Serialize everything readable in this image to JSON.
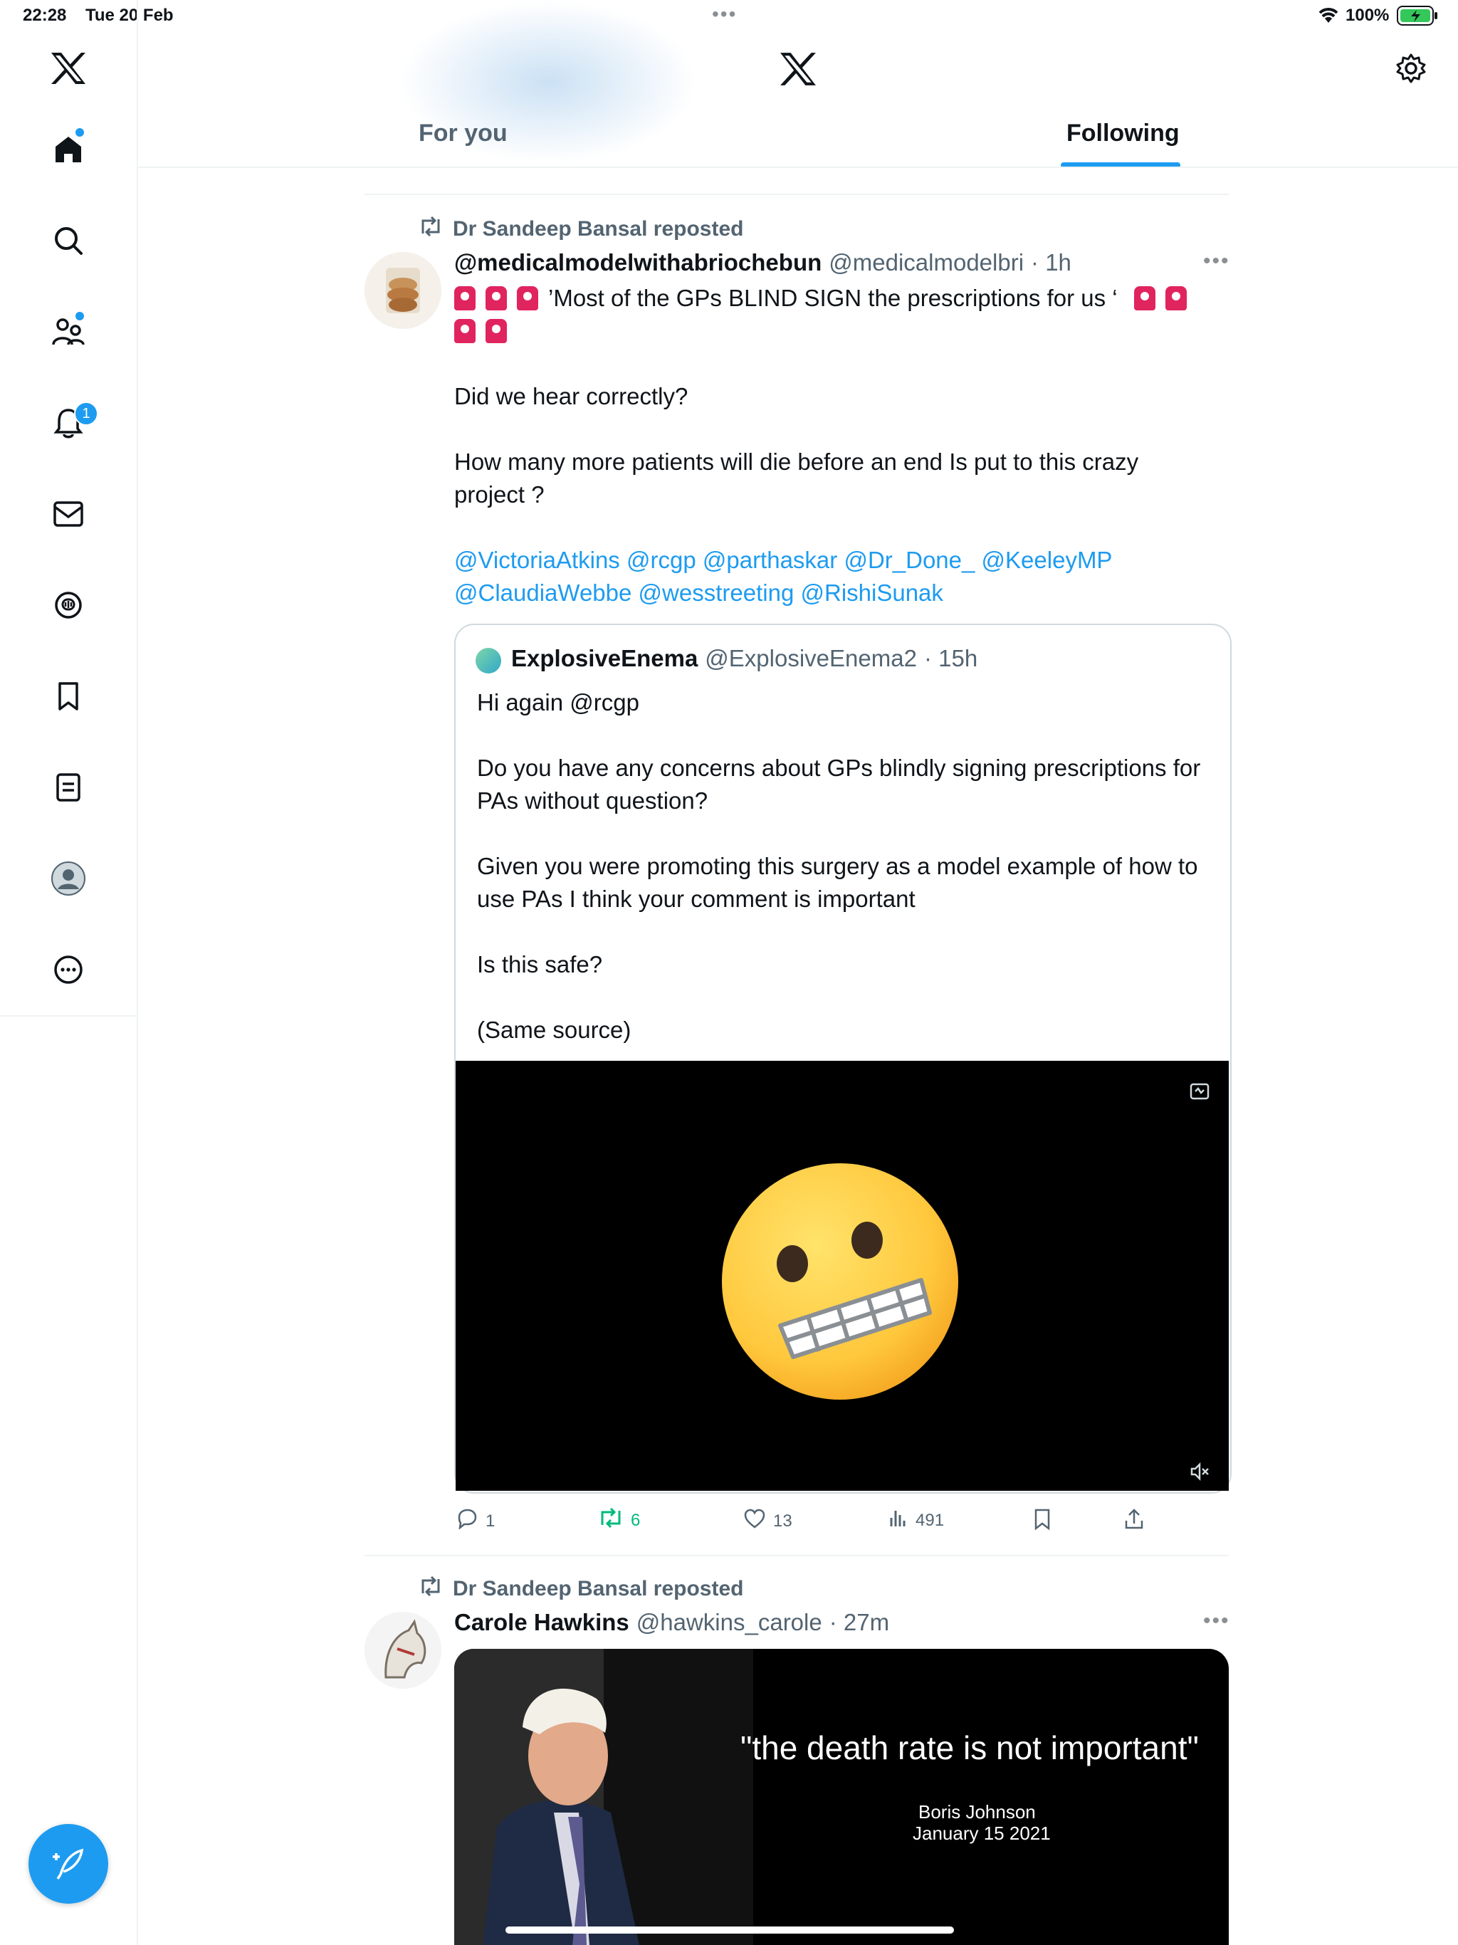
{
  "status_bar": {
    "time": "22:28",
    "date": "Tue 20 Feb",
    "battery": "100%"
  },
  "sidebar": {
    "items": [
      {
        "icon": "home-icon"
      },
      {
        "icon": "search-icon"
      },
      {
        "icon": "communities-icon"
      },
      {
        "icon": "bell-icon",
        "badge": "1"
      },
      {
        "icon": "mail-icon"
      },
      {
        "icon": "spaces-icon"
      },
      {
        "icon": "bookmark-icon"
      },
      {
        "icon": "lists-icon"
      },
      {
        "icon": "profile-icon"
      },
      {
        "icon": "more-icon"
      }
    ]
  },
  "header": {
    "logo": "x-logo-icon",
    "settings": "gear-icon"
  },
  "tabs": [
    {
      "label": "For you"
    },
    {
      "label": "Following",
      "active": true
    }
  ],
  "feed": {
    "tweet1": {
      "repost_label": "Dr Sandeep Bansal reposted",
      "name": "@medicalmodelwithabriochebun",
      "handle": "@medicalmodelbri",
      "time": "· 1h",
      "line1": "’Most of the GPs BLIND SIGN the prescriptions for us ‘",
      "p2": "Did we hear correctly?",
      "p3": "How many more patients will die before an end Is put to this crazy project ?",
      "mentions": [
        "@VictoriaAtkins",
        "@rcgp",
        "@parthaskar",
        "@Dr_Done_",
        "@KeeleyMP",
        "@ClaudiaWebbe",
        "@wesstreeting",
        "@RishiSunak"
      ],
      "quote": {
        "name": "ExplosiveEnema",
        "handle": "@ExplosiveEnema2",
        "time": "· 15h",
        "p1": "Hi again @rcgp",
        "p2": "Do you have any concerns about GPs blindly signing prescriptions for PAs without question?",
        "p3": "Given you were promoting this surgery as a model example of how to use PAs I think your comment is important",
        "p4": "Is this safe?",
        "p5": "(Same source)"
      },
      "actions": {
        "replies": "1",
        "reposts": "6",
        "likes": "13",
        "views": "491"
      }
    },
    "tweet2": {
      "repost_label": "Dr Sandeep Bansal reposted",
      "name": "Carole Hawkins",
      "handle": "@hawkins_carole",
      "time": "· 27m",
      "media_quote": "\"the death rate is not important\"",
      "media_attrib_name": "Boris Johnson",
      "media_attrib_date": "January 15 2021"
    }
  },
  "colors": {
    "accent": "#1d9bf0",
    "repost_green": "#00ba7c",
    "muted": "#536471"
  }
}
